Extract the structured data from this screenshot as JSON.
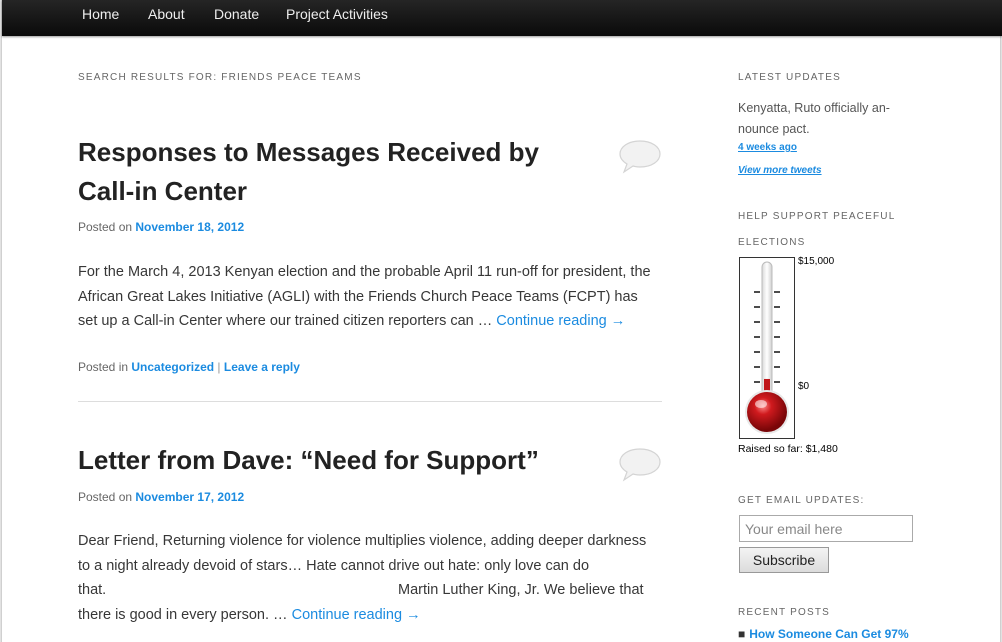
{
  "nav": {
    "items": [
      {
        "label": "Home"
      },
      {
        "label": "About"
      },
      {
        "label": "Donate"
      },
      {
        "label": "Project Activities"
      }
    ]
  },
  "archive": {
    "title": "Search Results for: Friends Peace Teams"
  },
  "posts": [
    {
      "title_line1": "Responses to Messages Received by",
      "title_line2": "Call-in Center",
      "posted_on": "Posted on",
      "date": "November 18, 2012",
      "summary": [
        "For the March 4, 2013 Kenyan election and the probable April 11 run-off for president, the",
        "African Great Lakes Initiative (AGLI) with the Friends Church Peace Teams (FCPT) has",
        "set up a Call-in Center where our trained citizen reporters can …"
      ],
      "continue": "Continue reading →",
      "posted_in": "Posted in",
      "category": "Uncategorized",
      "separator": "|",
      "reply": "Leave a reply"
    },
    {
      "title_line1": "Letter from Dave: “Need for Support”",
      "posted_on": "Posted on",
      "date": "November 17, 2012",
      "summary": [
        "Dear Friend, Returning violence for violence multiplies violence, adding deeper darkness",
        "to a night already devoid of stars… Hate cannot drive out hate: only love can do",
        "that.",
        "Martin Luther King, Jr. We believe that",
        "there is good in every person. …"
      ],
      "continue": "Continue reading →"
    }
  ],
  "sidebar": {
    "latest_updates": {
      "title": "Latest Updates",
      "tweet_line1": "Kenyatta, Ruto officially an-",
      "tweet_line2": "nounce pact.",
      "time": "4 weeks ago",
      "more": "View more tweets"
    },
    "support": {
      "title_line1": "Help Support Peaceful",
      "title_line2": "Elections",
      "goal_label": "$15,000",
      "zero_label": "$0",
      "raised_text": "Raised so far: $1,480",
      "fill_fraction": 0.0987,
      "mercury_color": "#c0171b"
    },
    "email": {
      "title": "Get Email Updates:",
      "placeholder": "Your email here",
      "button": "Subscribe"
    },
    "recent_posts": {
      "title": "Recent Posts",
      "bullet": "■",
      "first": "How Someone Can Get 97%"
    }
  },
  "colors": {
    "link": "#1b8be0",
    "navbar": "#0a0a0a"
  }
}
